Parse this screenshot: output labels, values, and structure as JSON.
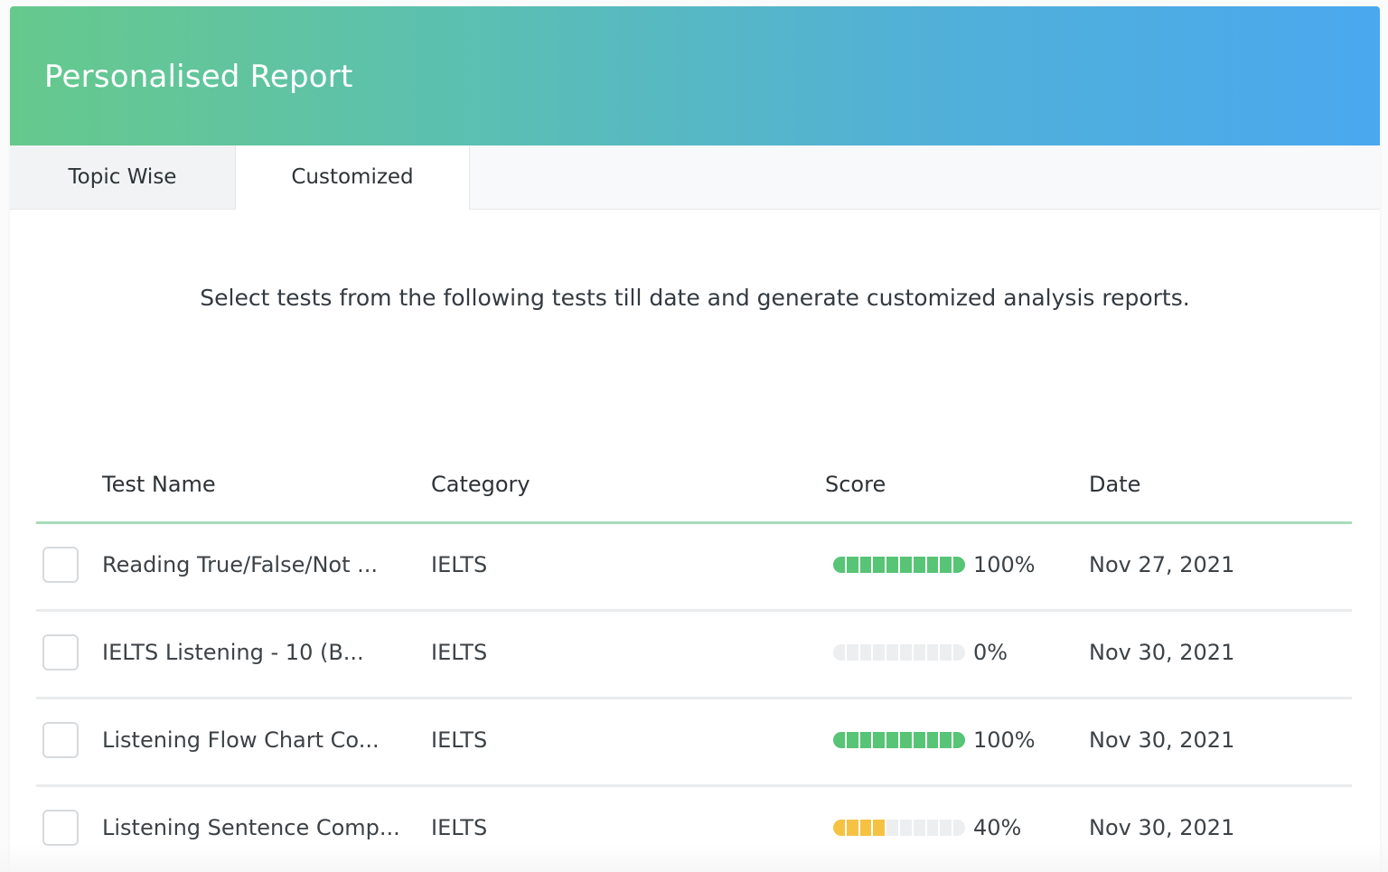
{
  "header": {
    "title": "Personalised Report"
  },
  "tabs": [
    {
      "label": "Topic Wise",
      "active": false
    },
    {
      "label": "Customized",
      "active": true
    }
  ],
  "description": "Select tests from the following tests till date and generate customized analysis reports.",
  "table": {
    "columns": {
      "name": "Test Name",
      "category": "Category",
      "score": "Score",
      "date": "Date"
    },
    "rows": [
      {
        "name": "Reading True/False/Not ...",
        "category": "IELTS",
        "score_pct": 100,
        "score_label": "100%",
        "score_color": "#57c476",
        "date": "Nov 27, 2021"
      },
      {
        "name": "IELTS Listening - 10 (B...",
        "category": "IELTS",
        "score_pct": 0,
        "score_label": "0%",
        "score_color": "#57c476",
        "date": "Nov 30, 2021"
      },
      {
        "name": "Listening Flow Chart Co...",
        "category": "IELTS",
        "score_pct": 100,
        "score_label": "100%",
        "score_color": "#57c476",
        "date": "Nov 30, 2021"
      },
      {
        "name": "Listening Sentence Comp...",
        "category": "IELTS",
        "score_pct": 40,
        "score_label": "40%",
        "score_color": "#f5c242",
        "date": "Nov 30, 2021"
      }
    ]
  },
  "colors": {
    "header_gradient_start": "#66c98c",
    "header_gradient_end": "#4aa8ef",
    "table_header_border": "#a8dcbc",
    "bar_empty": "#eceeef"
  }
}
